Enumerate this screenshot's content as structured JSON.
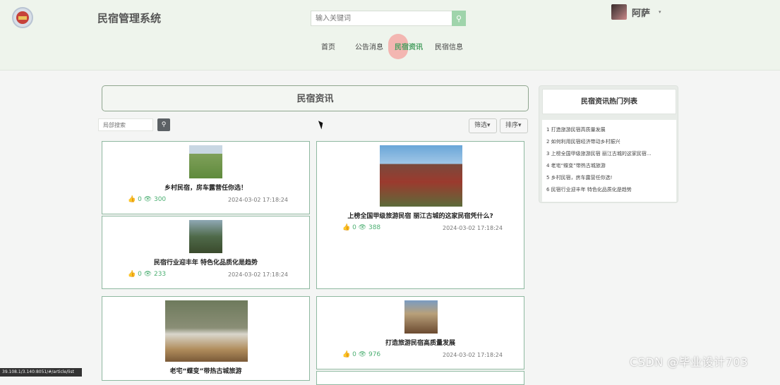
{
  "header": {
    "site_title": "民宿管理系统",
    "search_placeholder": "输入关键词",
    "search_icon": "search-icon",
    "user_name": "阿萨",
    "caret": "▾"
  },
  "nav": {
    "items": [
      "首页",
      "公告消息",
      "民宿资讯",
      "民宿信息"
    ],
    "active": 2
  },
  "page": {
    "title": "民宿资讯",
    "local_search_placeholder": "局部搜索",
    "filter_label": "筛选▾",
    "sort_label": "排序▾"
  },
  "cards": [
    {
      "title": "乡村民宿，房车露营任你选！",
      "likes": "0",
      "views": "300",
      "date": "2024-03-02 17:18:24"
    },
    {
      "title": "上榜全国甲级旅游民宿 丽江古城的这家民宿凭什么?",
      "likes": "0",
      "views": "388",
      "date": "2024-03-02 17:18:24"
    },
    {
      "title": "民宿行业迎丰年 特色化品质化是趋势",
      "likes": "0",
      "views": "233",
      "date": "2024-03-02 17:18:24"
    },
    {
      "title": "老宅“蝶变”带热古城旅游",
      "likes": "",
      "views": "",
      "date": ""
    },
    {
      "title": "打造旅游民宿高质量发展",
      "likes": "0",
      "views": "976",
      "date": "2024-03-02 17:18:24"
    }
  ],
  "sidebar": {
    "title": "民宿资讯热门列表",
    "items": [
      "1 打造旅游民宿高质量发展",
      "2 如何利用民宿经济带动乡村振兴",
      "3 上榜全国甲级旅游民宿 丽江古城的这家民宿...",
      "4 老宅“蝶变”带热古城旅游",
      "5 乡村民宿，房车露营任你选!",
      "6 民宿行业迎丰年 特色化品质化是趋势"
    ]
  },
  "statusbar": "39.108.1/3.140:8051/#/article/list",
  "watermark": "CSDN @毕业设计703",
  "colors": {
    "accent": "#4aa062",
    "card_border": "#8fb8a0",
    "header_bg": "#eef4ec"
  }
}
